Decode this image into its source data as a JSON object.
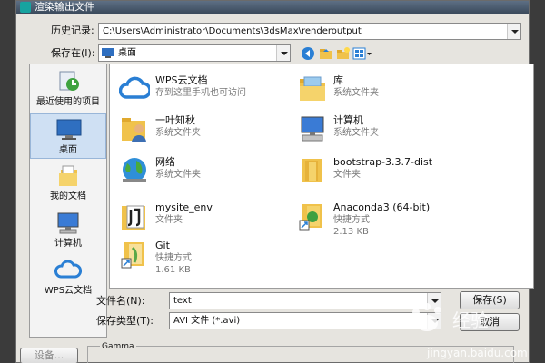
{
  "window": {
    "title": "渲染输出文件"
  },
  "history": {
    "label": "历史记录:",
    "value": "C:\\Users\\Administrator\\Documents\\3dsMax\\renderoutput"
  },
  "save_in": {
    "label": "保存在(I):",
    "value": "桌面"
  },
  "places": [
    {
      "label": "最近使用的项目",
      "icon": "recent-items-icon"
    },
    {
      "label": "桌面",
      "icon": "desktop-icon"
    },
    {
      "label": "我的文档",
      "icon": "documents-icon"
    },
    {
      "label": "计算机",
      "icon": "computer-icon"
    },
    {
      "label": "WPS云文档",
      "icon": "cloud-icon"
    }
  ],
  "files": [
    {
      "name": "WPS云文档",
      "line1": "存到这里手机也可访问",
      "line2": "",
      "icon": "cloud-icon"
    },
    {
      "name": "库",
      "line1": "系统文件夹",
      "line2": "",
      "icon": "library-folder-icon"
    },
    {
      "name": "一叶知秋",
      "line1": "系统文件夹",
      "line2": "",
      "icon": "user-folder-icon"
    },
    {
      "name": "计算机",
      "line1": "系统文件夹",
      "line2": "",
      "icon": "computer-icon"
    },
    {
      "name": "网络",
      "line1": "系统文件夹",
      "line2": "",
      "icon": "network-globe-icon"
    },
    {
      "name": "bootstrap-3.3.7-dist",
      "line1": "文件夹",
      "line2": "",
      "icon": "folder-icon"
    },
    {
      "name": "mysite_env",
      "line1": "文件夹",
      "line2": "",
      "icon": "folder-icon"
    },
    {
      "name": "Anaconda3 (64-bit)",
      "line1": "快捷方式",
      "line2": "2.13 KB",
      "icon": "shortcut-icon"
    },
    {
      "name": "Git",
      "line1": "快捷方式",
      "line2": "1.61 KB",
      "icon": "shortcut-icon"
    }
  ],
  "filename": {
    "label": "文件名(N):",
    "value": "text"
  },
  "filetype": {
    "label": "保存类型(T):",
    "value": "AVI 文件 (*.avi)"
  },
  "buttons": {
    "save": "保存(S)",
    "cancel": "取消",
    "setup": "设备..."
  },
  "gamma": {
    "label": "Gamma"
  },
  "watermark": {
    "text": "jingyan.baidu.com",
    "brand": "经验"
  }
}
